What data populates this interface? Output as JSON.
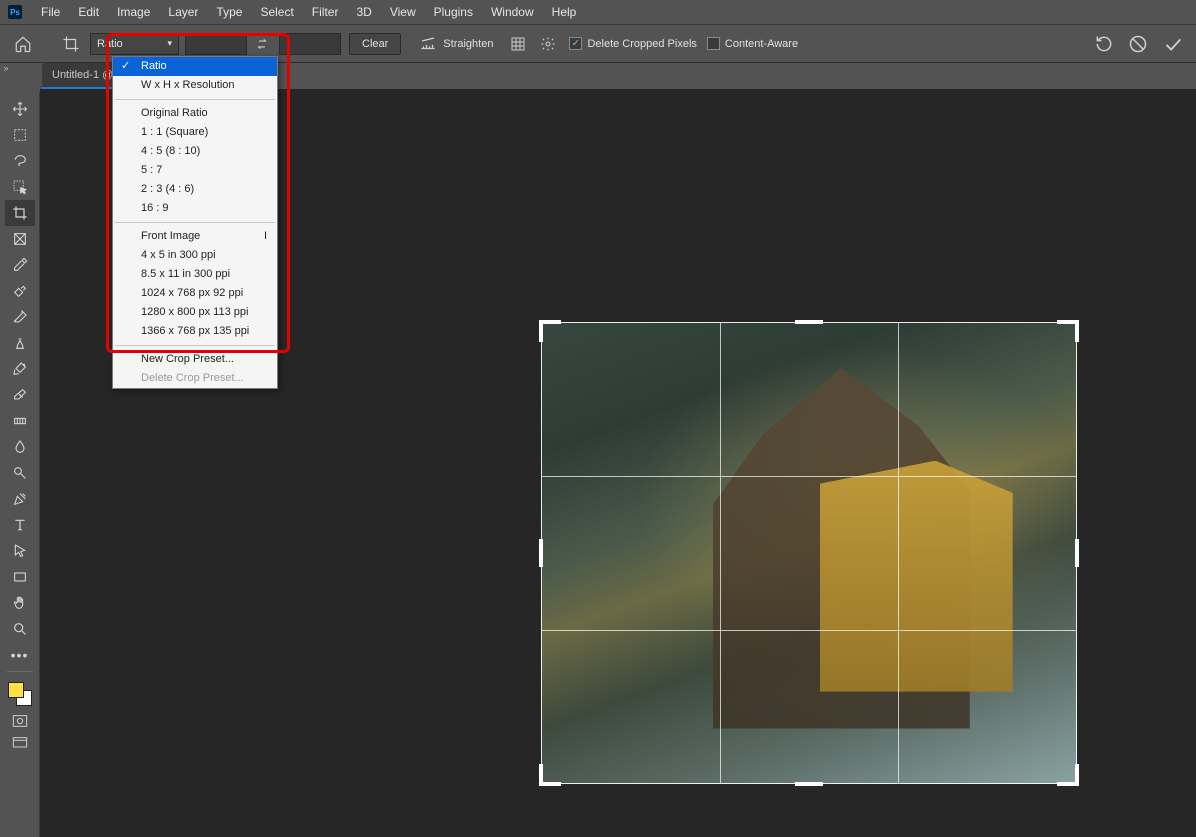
{
  "menubar": {
    "items": [
      "File",
      "Edit",
      "Image",
      "Layer",
      "Type",
      "Select",
      "Filter",
      "3D",
      "View",
      "Plugins",
      "Window",
      "Help"
    ]
  },
  "optionsbar": {
    "ratio_select": "Ratio",
    "clear_label": "Clear",
    "straighten_label": "Straighten",
    "delete_cropped_label": "Delete Cropped Pixels",
    "content_aware_label": "Content-Aware",
    "delete_cropped_checked": true,
    "content_aware_checked": false
  },
  "dropdown": {
    "group1": [
      "Ratio",
      "W x H x Resolution"
    ],
    "group2": [
      "Original Ratio",
      "1 : 1 (Square)",
      "4 : 5 (8 : 10)",
      "5 : 7",
      "2 : 3 (4 : 6)",
      "16 : 9"
    ],
    "group3_front": "Front Image",
    "group3_front_shortcut": "I",
    "group3": [
      "4 x 5 in 300 ppi",
      "8.5 x 11 in 300 ppi",
      "1024 x 768 px 92 ppi",
      "1280 x 800 px 113 ppi",
      "1366 x 768 px 135 ppi"
    ],
    "group4": [
      "New Crop Preset...",
      "Delete Crop Preset..."
    ],
    "selected_index": 0
  },
  "tab": {
    "label": "Untitled-1 @"
  },
  "tools": [
    "move",
    "marquee",
    "lasso",
    "object-select",
    "crop",
    "frame",
    "eyedropper",
    "healing",
    "brush",
    "clone",
    "history-brush",
    "eraser",
    "gradient",
    "blur",
    "dodge",
    "pen",
    "type",
    "path-select",
    "rectangle",
    "hand",
    "zoom"
  ],
  "colors": {
    "foreground": "#ffe23d",
    "background": "#ffffff",
    "highlight": "#e60000"
  }
}
